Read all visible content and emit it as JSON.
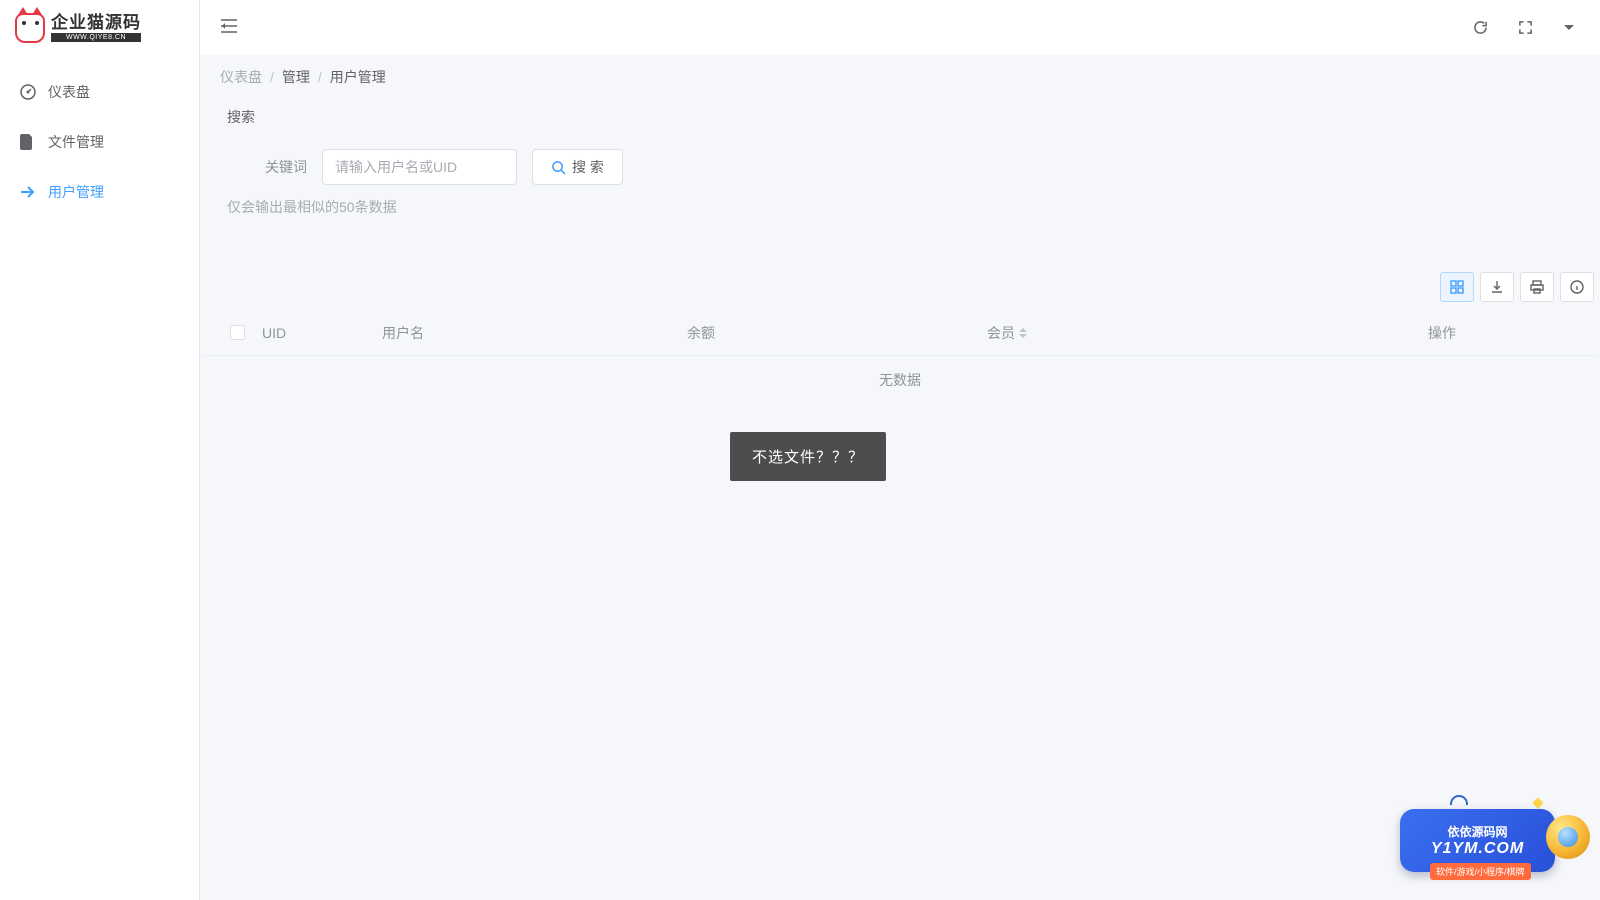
{
  "brand": {
    "name": "企业猫源码",
    "sub": "WWW.QIYE8.CN"
  },
  "sidebar": {
    "items": [
      {
        "label": "仪表盘",
        "icon": "dashboard-icon"
      },
      {
        "label": "文件管理",
        "icon": "file-icon"
      },
      {
        "label": "用户管理",
        "icon": "share-icon"
      }
    ],
    "active_index": 2
  },
  "topbar": {
    "icons": [
      "refresh-icon",
      "fullscreen-icon",
      "caret-down-icon"
    ]
  },
  "breadcrumb": {
    "root": "仪表盘",
    "items": [
      "管理",
      "用户管理"
    ],
    "sep": "/"
  },
  "search": {
    "title": "搜索",
    "keyword_label": "关键词",
    "placeholder": "请输入用户名或UID",
    "button_label": "搜 索",
    "hint": "仅会输出最相似的50条数据",
    "value": ""
  },
  "table": {
    "tools": [
      "card-view-icon",
      "download-icon",
      "print-icon",
      "info-icon"
    ],
    "active_tool_index": 0,
    "columns": {
      "uid": "UID",
      "username": "用户名",
      "balance": "余额",
      "member": "会员",
      "ops": "操作"
    },
    "rows": [],
    "empty_text": "无数据"
  },
  "tooltip": {
    "text": "不选文件？？？"
  },
  "watermark": {
    "title": "依依源码网",
    "domain": "Y1YM.COM",
    "tag": "软件/游戏/小程序/棋牌"
  },
  "colors": {
    "primary": "#409eff",
    "accent_red": "#e63946",
    "text_muted": "#a8abb2"
  }
}
